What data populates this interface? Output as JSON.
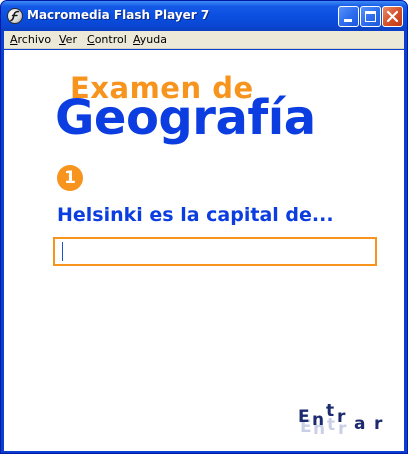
{
  "window": {
    "title": "Macromedia Flash Player 7"
  },
  "menu": {
    "items": [
      "Archivo",
      "Ver",
      "Control",
      "Ayuda"
    ]
  },
  "quiz": {
    "title_line1": "Examen de",
    "title_line2": "Geografía",
    "question_number": "1",
    "question_text": "Helsinki es la capital de...",
    "answer_value": "",
    "enter_letters": [
      "E",
      "n",
      "t",
      "r",
      "a",
      "r"
    ]
  },
  "colors": {
    "accent_orange": "#f7941e",
    "accent_blue": "#0b3de0",
    "enter_dark": "#1c2a6e",
    "titlebar_blue": "#0a4fe0"
  },
  "icons": {
    "app": "flash-player-icon",
    "minimize": "minimize-icon",
    "maximize": "maximize-icon",
    "close": "close-icon"
  }
}
